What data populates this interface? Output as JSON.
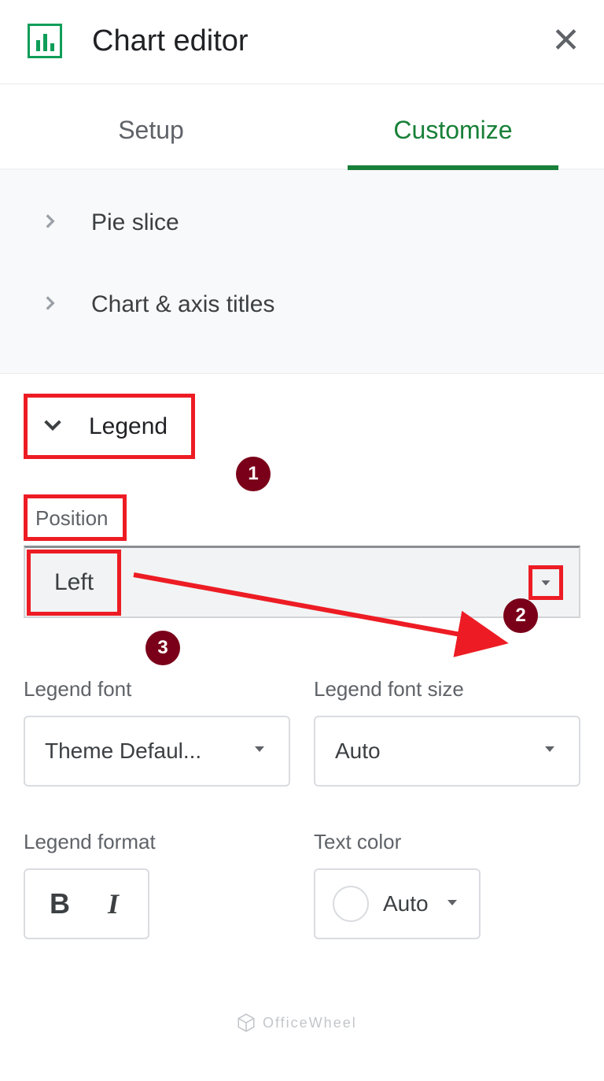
{
  "header": {
    "title": "Chart editor"
  },
  "tabs": {
    "setup": "Setup",
    "customize": "Customize",
    "active": "customize"
  },
  "accordions": {
    "pie_slice": "Pie slice",
    "chart_axis_titles": "Chart & axis titles",
    "legend": "Legend"
  },
  "annotations": {
    "b1": "1",
    "b2": "2",
    "b3": "3"
  },
  "legend_panel": {
    "position_label": "Position",
    "position_value": "Left",
    "font_label": "Legend font",
    "font_value": "Theme Defaul...",
    "size_label": "Legend font size",
    "size_value": "Auto",
    "format_label": "Legend format",
    "color_label": "Text color",
    "color_value": "Auto"
  },
  "watermark": "OfficeWheel"
}
